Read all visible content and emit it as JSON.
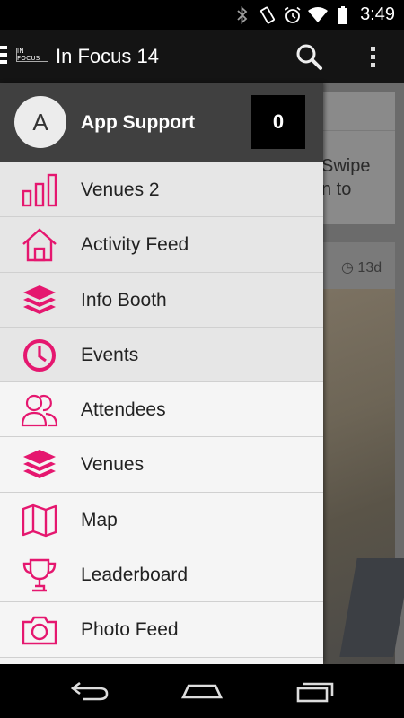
{
  "status_bar": {
    "time": "3:49",
    "icons": [
      "bluetooth-icon",
      "vibrate-icon",
      "alarm-icon",
      "wifi-icon",
      "battery-icon"
    ]
  },
  "action_bar": {
    "logo_text": "IN FOCUS",
    "title": "In Focus 14",
    "icons": [
      "nav-drawer-icon",
      "search-icon",
      "overflow-menu-icon"
    ]
  },
  "background": {
    "card_text_line1": "Swipe",
    "card_text_line2": "n to",
    "post_age": "13d"
  },
  "drawer": {
    "avatar_initial": "A",
    "user_name": "App Support",
    "count": "0",
    "items": [
      {
        "label": "Venues 2",
        "icon": "bar-chart-icon"
      },
      {
        "label": "Activity Feed",
        "icon": "home-icon"
      },
      {
        "label": "Info Booth",
        "icon": "layers-icon"
      },
      {
        "label": "Events",
        "icon": "clock-icon"
      },
      {
        "label": "Attendees",
        "icon": "people-icon"
      },
      {
        "label": "Venues",
        "icon": "layers-icon"
      },
      {
        "label": "Map",
        "icon": "map-icon"
      },
      {
        "label": "Leaderboard",
        "icon": "trophy-icon"
      },
      {
        "label": "Photo Feed",
        "icon": "camera-icon"
      }
    ]
  },
  "nav_bar": {
    "icons": [
      "back-icon",
      "home-icon",
      "recent-apps-icon"
    ]
  },
  "colors": {
    "accent": "#e5176f",
    "header_bg": "#404040",
    "action_bar_bg": "#141414"
  }
}
